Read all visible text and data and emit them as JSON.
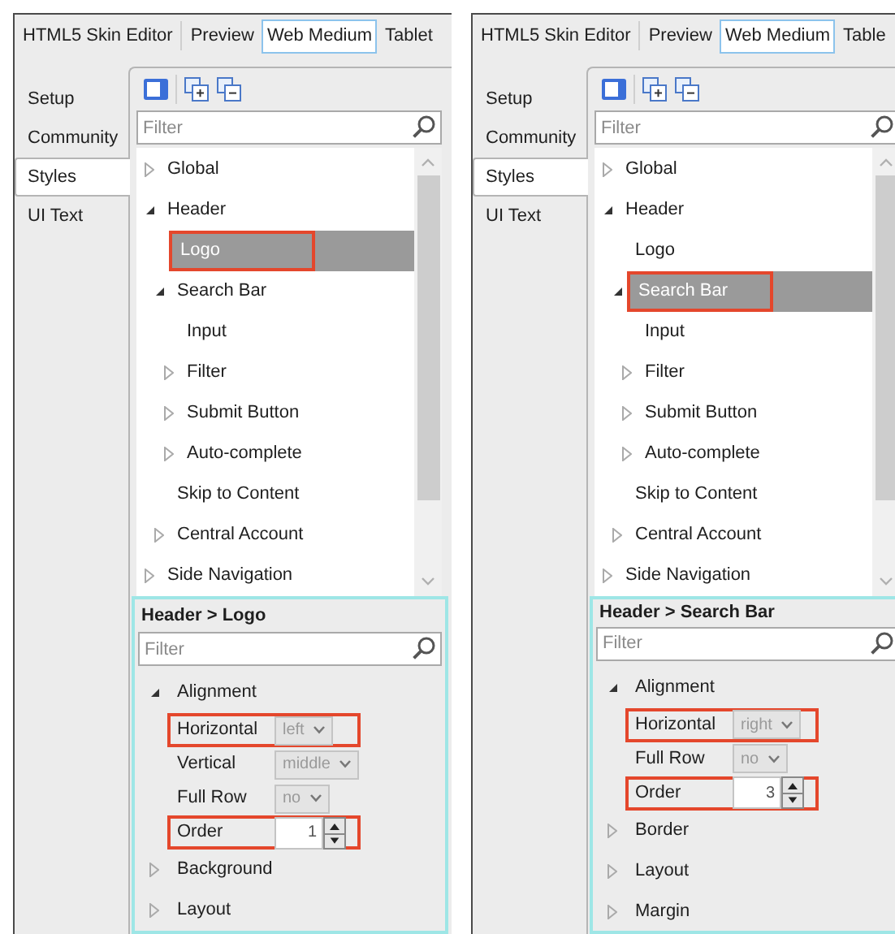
{
  "panels": [
    {
      "top_tabs": [
        {
          "label": "HTML5 Skin Editor",
          "selected": false
        },
        {
          "label": "Preview",
          "selected": false
        },
        {
          "label": "Web Medium",
          "selected": true
        },
        {
          "label": "Tablet",
          "selected": false
        }
      ],
      "side_tabs": [
        {
          "label": "Setup",
          "selected": false
        },
        {
          "label": "Community",
          "selected": false
        },
        {
          "label": "Styles",
          "selected": true
        },
        {
          "label": "UI Text",
          "selected": false
        }
      ],
      "filter": {
        "placeholder": "Filter"
      },
      "tree": [
        {
          "label": "Global",
          "kind": "branch",
          "expanded": false,
          "selected": false,
          "highlighted": false
        },
        {
          "label": "Header",
          "kind": "branch",
          "expanded": true,
          "selected": false,
          "highlighted": false,
          "children": [
            {
              "label": "Logo",
              "kind": "leaf",
              "selected": true,
              "highlighted": true
            },
            {
              "label": "Search Bar",
              "kind": "branch",
              "expanded": true,
              "selected": false,
              "highlighted": false,
              "children": [
                {
                  "label": "Input",
                  "kind": "leaf",
                  "selected": false,
                  "highlighted": false
                },
                {
                  "label": "Filter",
                  "kind": "branch",
                  "expanded": false,
                  "selected": false,
                  "highlighted": false
                },
                {
                  "label": "Submit Button",
                  "kind": "branch",
                  "expanded": false,
                  "selected": false,
                  "highlighted": false
                },
                {
                  "label": "Auto-complete",
                  "kind": "branch",
                  "expanded": false,
                  "selected": false,
                  "highlighted": false
                }
              ]
            },
            {
              "label": "Skip to Content",
              "kind": "leaf",
              "selected": false,
              "highlighted": false
            },
            {
              "label": "Central Account",
              "kind": "branch",
              "expanded": false,
              "selected": false,
              "highlighted": false
            }
          ]
        },
        {
          "label": "Side Navigation",
          "kind": "branch",
          "expanded": false,
          "selected": false,
          "highlighted": false
        }
      ],
      "properties": {
        "title": "Header > Logo",
        "filter": {
          "placeholder": "Filter"
        },
        "groups": [
          {
            "label": "Alignment",
            "expanded": true,
            "rows": [
              {
                "label": "Horizontal",
                "kind": "dropdown",
                "value": "left",
                "highlighted": true
              },
              {
                "label": "Vertical",
                "kind": "dropdown",
                "value": "middle",
                "highlighted": false
              },
              {
                "label": "Full Row",
                "kind": "dropdown",
                "value": "no",
                "highlighted": false
              },
              {
                "label": "Order",
                "kind": "spinner",
                "value": "1",
                "highlighted": true
              }
            ]
          },
          {
            "label": "Background",
            "expanded": false
          },
          {
            "label": "Layout",
            "expanded": false
          }
        ]
      }
    },
    {
      "top_tabs": [
        {
          "label": "HTML5 Skin Editor",
          "selected": false
        },
        {
          "label": "Preview",
          "selected": false
        },
        {
          "label": "Web Medium",
          "selected": true
        },
        {
          "label": "Table",
          "selected": false
        }
      ],
      "side_tabs": [
        {
          "label": "Setup",
          "selected": false
        },
        {
          "label": "Community",
          "selected": false
        },
        {
          "label": "Styles",
          "selected": true
        },
        {
          "label": "UI Text",
          "selected": false
        }
      ],
      "filter": {
        "placeholder": "Filter"
      },
      "tree": [
        {
          "label": "Global",
          "kind": "branch",
          "expanded": false,
          "selected": false,
          "highlighted": false
        },
        {
          "label": "Header",
          "kind": "branch",
          "expanded": true,
          "selected": false,
          "highlighted": false,
          "children": [
            {
              "label": "Logo",
              "kind": "leaf",
              "selected": false,
              "highlighted": false
            },
            {
              "label": "Search Bar",
              "kind": "branch",
              "expanded": true,
              "selected": true,
              "highlighted": true,
              "children": [
                {
                  "label": "Input",
                  "kind": "leaf",
                  "selected": false,
                  "highlighted": false
                },
                {
                  "label": "Filter",
                  "kind": "branch",
                  "expanded": false,
                  "selected": false,
                  "highlighted": false
                },
                {
                  "label": "Submit Button",
                  "kind": "branch",
                  "expanded": false,
                  "selected": false,
                  "highlighted": false
                },
                {
                  "label": "Auto-complete",
                  "kind": "branch",
                  "expanded": false,
                  "selected": false,
                  "highlighted": false
                }
              ]
            },
            {
              "label": "Skip to Content",
              "kind": "leaf",
              "selected": false,
              "highlighted": false
            },
            {
              "label": "Central Account",
              "kind": "branch",
              "expanded": false,
              "selected": false,
              "highlighted": false
            }
          ]
        },
        {
          "label": "Side Navigation",
          "kind": "branch",
          "expanded": false,
          "selected": false,
          "highlighted": false
        }
      ],
      "properties": {
        "title": "Header > Search Bar",
        "filter": {
          "placeholder": "Filter"
        },
        "groups": [
          {
            "label": "Alignment",
            "expanded": true,
            "rows": [
              {
                "label": "Horizontal",
                "kind": "dropdown",
                "value": "right",
                "highlighted": true
              },
              {
                "label": "Full Row",
                "kind": "dropdown",
                "value": "no",
                "highlighted": false
              },
              {
                "label": "Order",
                "kind": "spinner",
                "value": "3",
                "highlighted": true
              }
            ]
          },
          {
            "label": "Border",
            "expanded": false
          },
          {
            "label": "Layout",
            "expanded": false
          },
          {
            "label": "Margin",
            "expanded": false
          }
        ]
      }
    }
  ]
}
